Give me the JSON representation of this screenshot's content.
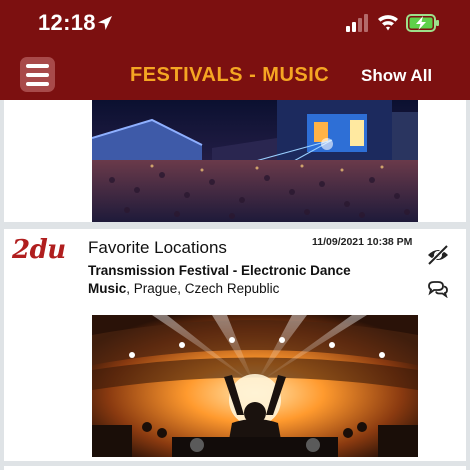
{
  "status_bar": {
    "time": "12:18"
  },
  "nav": {
    "title": "FESTIVALS - MUSIC",
    "show_all_label": "Show All"
  },
  "posts": [
    {
      "logo_text": "2du",
      "title": "Favorite Locations",
      "date": "11/09/2021 10:38 PM",
      "event": "Transmission Festival - Electronic Dance Music",
      "location": ", Prague, Czech Republic"
    }
  ],
  "colors": {
    "header_bg": "#7c1010",
    "title_accent": "#f5a623",
    "logo_red": "#b01e1e",
    "feed_bg": "#dfe3e6"
  },
  "icons": [
    "location-arrow-icon",
    "cellular-signal-icon",
    "wifi-icon",
    "battery-charging-icon",
    "menu-icon",
    "hide-eye-icon",
    "comments-icon"
  ]
}
